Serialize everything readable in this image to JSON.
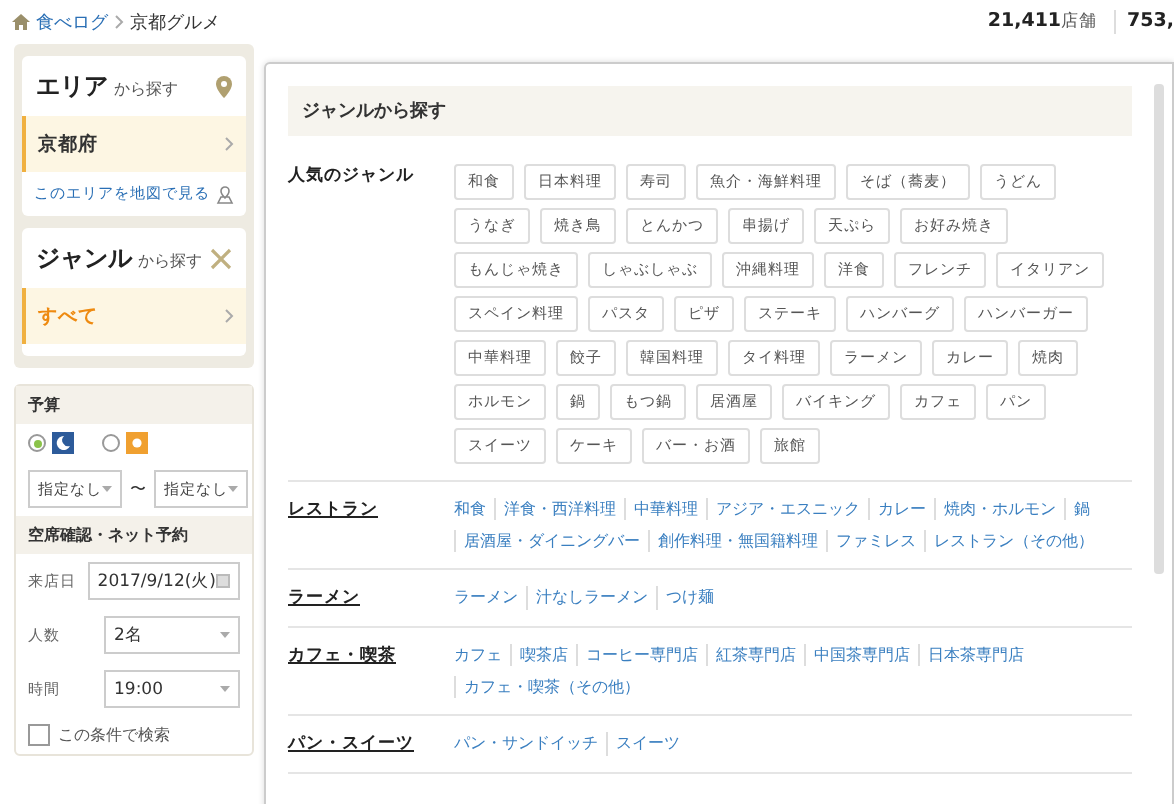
{
  "breadcrumb": {
    "home": "食べログ",
    "current": "京都グルメ"
  },
  "stats": [
    {
      "value": "21,411",
      "unit": "店舗"
    },
    {
      "value": "753,"
    }
  ],
  "area_card": {
    "title": "エリア",
    "suffix": "から探す",
    "value": "京都府",
    "link": "このエリアを地図で見る"
  },
  "genre_card": {
    "title": "ジャンル",
    "suffix": "から探す",
    "value": "すべて"
  },
  "budget": {
    "title": "予算",
    "options": [
      {
        "kind": "dinner",
        "selected": true
      },
      {
        "kind": "lunch",
        "selected": false
      }
    ],
    "from": "指定なし",
    "tilde": "〜",
    "to": "指定なし"
  },
  "reservation": {
    "title": "空席確認・ネット予約",
    "fields": [
      {
        "label": "来店日",
        "value": "2017/9/12(火)",
        "kind": "date"
      },
      {
        "label": "人数",
        "value": "2名",
        "kind": "select"
      },
      {
        "label": "時間",
        "value": "19:00",
        "kind": "select"
      }
    ],
    "checkbox": {
      "label": "この条件で検索",
      "checked": false
    }
  },
  "popup": {
    "title": "ジャンルから探す",
    "popular": {
      "label": "人気のジャンル",
      "tags": [
        "和食",
        "日本料理",
        "寿司",
        "魚介・海鮮料理",
        "そば（蕎麦）",
        "うどん",
        "うなぎ",
        "焼き鳥",
        "とんかつ",
        "串揚げ",
        "天ぷら",
        "お好み焼き",
        "もんじゃ焼き",
        "しゃぶしゃぶ",
        "沖縄料理",
        "洋食",
        "フレンチ",
        "イタリアン",
        "スペイン料理",
        "パスタ",
        "ピザ",
        "ステーキ",
        "ハンバーグ",
        "ハンバーガー",
        "中華料理",
        "餃子",
        "韓国料理",
        "タイ料理",
        "ラーメン",
        "カレー",
        "焼肉",
        "ホルモン",
        "鍋",
        "もつ鍋",
        "居酒屋",
        "バイキング",
        "カフェ",
        "パン",
        "スイーツ",
        "ケーキ",
        "バー・お酒",
        "旅館"
      ]
    },
    "categories": [
      {
        "label": "レストラン",
        "links": [
          "和食",
          "洋食・西洋料理",
          "中華料理",
          "アジア・エスニック",
          "カレー",
          "焼肉・ホルモン",
          "鍋",
          "居酒屋・ダイニングバー",
          "創作料理・無国籍料理",
          "ファミレス",
          "レストラン（その他）"
        ]
      },
      {
        "label": "ラーメン",
        "links": [
          "ラーメン",
          "汁なしラーメン",
          "つけ麺"
        ]
      },
      {
        "label": "カフェ・喫茶",
        "links": [
          "カフェ",
          "喫茶店",
          "コーヒー専門店",
          "紅茶専門店",
          "中国茶専門店",
          "日本茶専門店",
          "カフェ・喫茶（その他）"
        ]
      },
      {
        "label": "パン・スイーツ",
        "links": [
          "パン・サンドイッチ",
          "スイーツ"
        ]
      }
    ]
  }
}
